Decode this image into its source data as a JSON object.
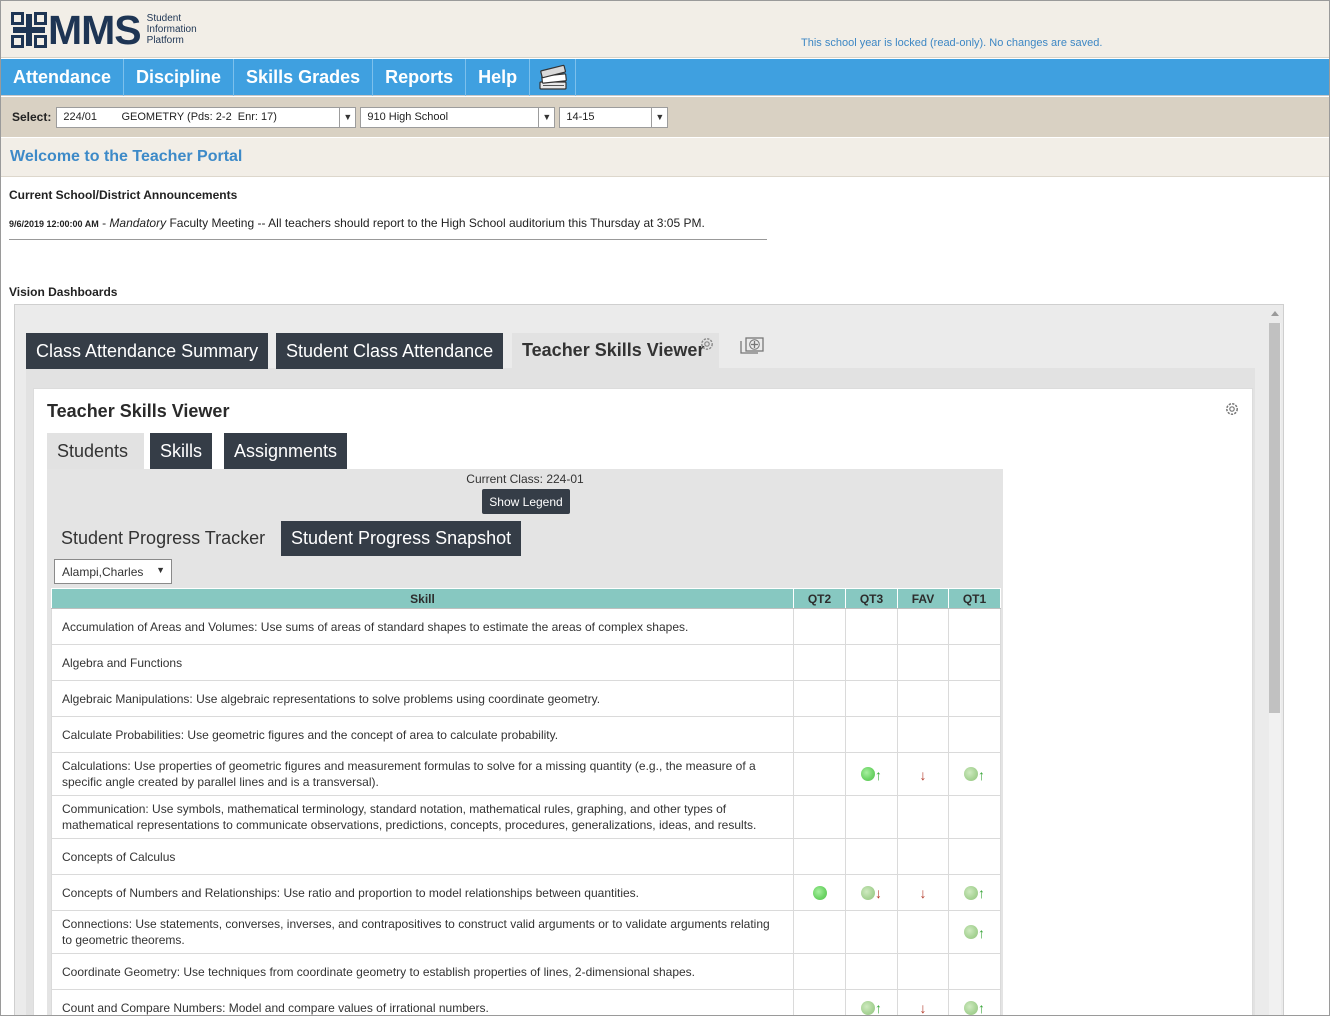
{
  "header": {
    "logo_text": "MMS",
    "logo_sub": [
      "Student",
      "Information",
      "Platform"
    ],
    "locked_message": "This school year is locked (read-only). No changes are saved."
  },
  "nav": {
    "items": [
      "Attendance",
      "Discipline",
      "Skills Grades",
      "Reports",
      "Help"
    ],
    "icon": "books-icon"
  },
  "select_bar": {
    "label": "Select:",
    "class_value": "224/01        GEOMETRY (Pds: 2-2  Enr: 17)",
    "school_value": "910 High School",
    "year_value": "14-15"
  },
  "welcome": "Welcome to the Teacher Portal",
  "announcements": {
    "title": "Current School/District Announcements",
    "items": [
      {
        "date": "9/6/2019 12:00:00 AM",
        "separator": " - ",
        "emphasis": "Mandatory",
        "text": " Faculty Meeting -- All teachers should report to the High School auditorium this Thursday at 3:05 PM."
      }
    ]
  },
  "vision": {
    "title": "Vision Dashboards",
    "tabs": [
      "Class Attendance Summary",
      "Student Class Attendance",
      "Teacher Skills Viewer"
    ],
    "active_tab": "Teacher Skills Viewer"
  },
  "viewer": {
    "title": "Teacher Skills Viewer",
    "tabs": [
      "Students",
      "Skills",
      "Assignments"
    ],
    "current_class": "Current Class: 224-01",
    "legend_button": "Show Legend",
    "progress_tabs": [
      "Student Progress Tracker",
      "Student Progress Snapshot"
    ],
    "student": "Alampi,Charles",
    "columns": [
      "Skill",
      "QT2",
      "QT3",
      "FAV",
      "QT1"
    ],
    "rows": [
      {
        "skill": "Accumulation of Areas and Volumes: Use sums of areas of standard shapes to estimate the areas of complex shapes.",
        "marks": [
          "",
          "",
          "",
          ""
        ]
      },
      {
        "skill": "Algebra and Functions",
        "marks": [
          "",
          "",
          "",
          ""
        ]
      },
      {
        "skill": "Algebraic Manipulations: Use algebraic representations to solve problems using coordinate geometry.",
        "marks": [
          "",
          "",
          "",
          ""
        ]
      },
      {
        "skill": "Calculate Probabilities: Use geometric figures and the concept of area to calculate probability.",
        "marks": [
          "",
          "",
          "",
          ""
        ]
      },
      {
        "skill": "Calculations: Use properties of geometric figures and measurement formulas to solve for a missing quantity (e.g., the measure of a specific angle created by parallel lines and is a transversal).",
        "marks": [
          "",
          "dot-strong-up",
          "down",
          "dot-up"
        ]
      },
      {
        "skill": "Communication: Use symbols, mathematical terminology, standard notation, mathematical rules, graphing, and other types of mathematical representations to communicate observations, predictions, concepts, procedures, generalizations, ideas, and results.",
        "marks": [
          "",
          "",
          "",
          ""
        ]
      },
      {
        "skill": "Concepts of Calculus",
        "marks": [
          "",
          "",
          "",
          ""
        ]
      },
      {
        "skill": "Concepts of Numbers and Relationships: Use ratio and proportion to model relationships between quantities.",
        "marks": [
          "dot-strong",
          "dot-down",
          "down",
          "dot-up"
        ]
      },
      {
        "skill": "Connections: Use statements, converses, inverses, and contrapositives to construct valid arguments or to validate arguments relating to geometric theorems.",
        "marks": [
          "",
          "",
          "",
          "dot-up"
        ]
      },
      {
        "skill": "Coordinate Geometry: Use techniques from coordinate geometry to establish properties of lines, 2-dimensional shapes.",
        "marks": [
          "",
          "",
          "",
          ""
        ]
      },
      {
        "skill": "Count and Compare Numbers: Model and compare values of irrational numbers.",
        "marks": [
          "",
          "dot-up",
          "down",
          "dot-up"
        ]
      }
    ]
  },
  "colors": {
    "nav_bg": "#3fa0e0",
    "tab_dark": "#353d47",
    "header_teal": "#87c8c1",
    "welcome_text": "#3d8ac8"
  }
}
